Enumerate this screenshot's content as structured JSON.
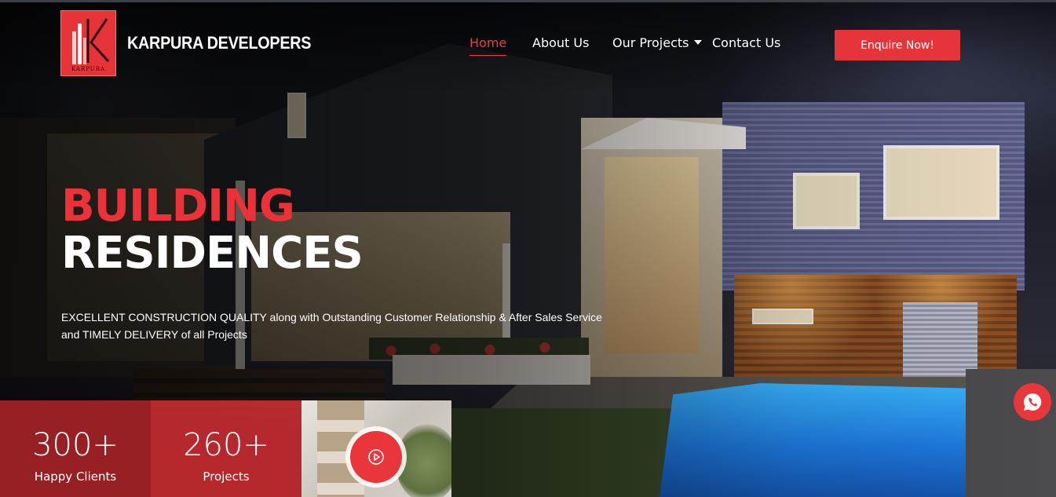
{
  "header": {
    "brand_name": "KARPURA DEVELOPERS",
    "logo_text": "KARPURA",
    "logo_color": "#e63338"
  },
  "nav": {
    "items": [
      {
        "label": "Home",
        "active": true
      },
      {
        "label": "About Us",
        "active": false
      },
      {
        "label": "Our Projects",
        "active": false,
        "has_dropdown": true
      },
      {
        "label": "Contact Us",
        "active": false
      }
    ],
    "active_color": "#ef3b3f"
  },
  "cta": {
    "label": "Enquire Now!",
    "color": "#e6353a"
  },
  "hero": {
    "title_line1": "BUILDING",
    "title_line2": "RESIDENCES",
    "tagline_line1": "EXCELLENT CONSTRUCTION QUALITY along with Outstanding Customer Relationship & After Sales Service",
    "tagline_line2": "and TIMELY DELIVERY of all Projects"
  },
  "stats": [
    {
      "value": "300+",
      "label": "Happy Clients"
    },
    {
      "value": "260+",
      "label": "Projects"
    }
  ],
  "icons": {
    "play": "play-circle-icon",
    "whatsapp": "whatsapp-icon",
    "dropdown": "chevron-down-icon"
  }
}
